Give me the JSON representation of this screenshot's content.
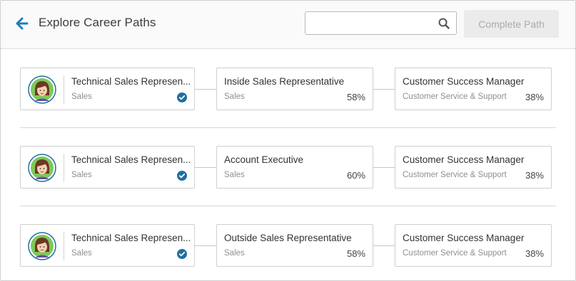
{
  "header": {
    "title": "Explore Career Paths",
    "search_placeholder": "",
    "search_value": "",
    "complete_label": "Complete Path",
    "back_icon": "back-arrow-icon",
    "search_icon": "search-icon"
  },
  "colors": {
    "accent": "#1a7fc1",
    "check": "#1f6f9f",
    "button_disabled_bg": "#ebebeb",
    "button_disabled_text": "#ababab"
  },
  "paths": [
    {
      "current": {
        "title": "Technical Sales Represen...",
        "category": "Sales",
        "completed": true
      },
      "next": {
        "title": "Inside Sales Representative",
        "category": "Sales",
        "match": "58%"
      },
      "target": {
        "title": "Customer Success Manager",
        "category": "Customer Service & Support",
        "match": "38%"
      }
    },
    {
      "current": {
        "title": "Technical Sales Represen...",
        "category": "Sales",
        "completed": true
      },
      "next": {
        "title": "Account Executive",
        "category": "Sales",
        "match": "60%"
      },
      "target": {
        "title": "Customer Success Manager",
        "category": "Customer Service & Support",
        "match": "38%"
      }
    },
    {
      "current": {
        "title": "Technical Sales Represen...",
        "category": "Sales",
        "completed": true
      },
      "next": {
        "title": "Outside Sales Representative",
        "category": "Sales",
        "match": "58%"
      },
      "target": {
        "title": "Customer Success Manager",
        "category": "Customer Service & Support",
        "match": "38%"
      }
    }
  ]
}
